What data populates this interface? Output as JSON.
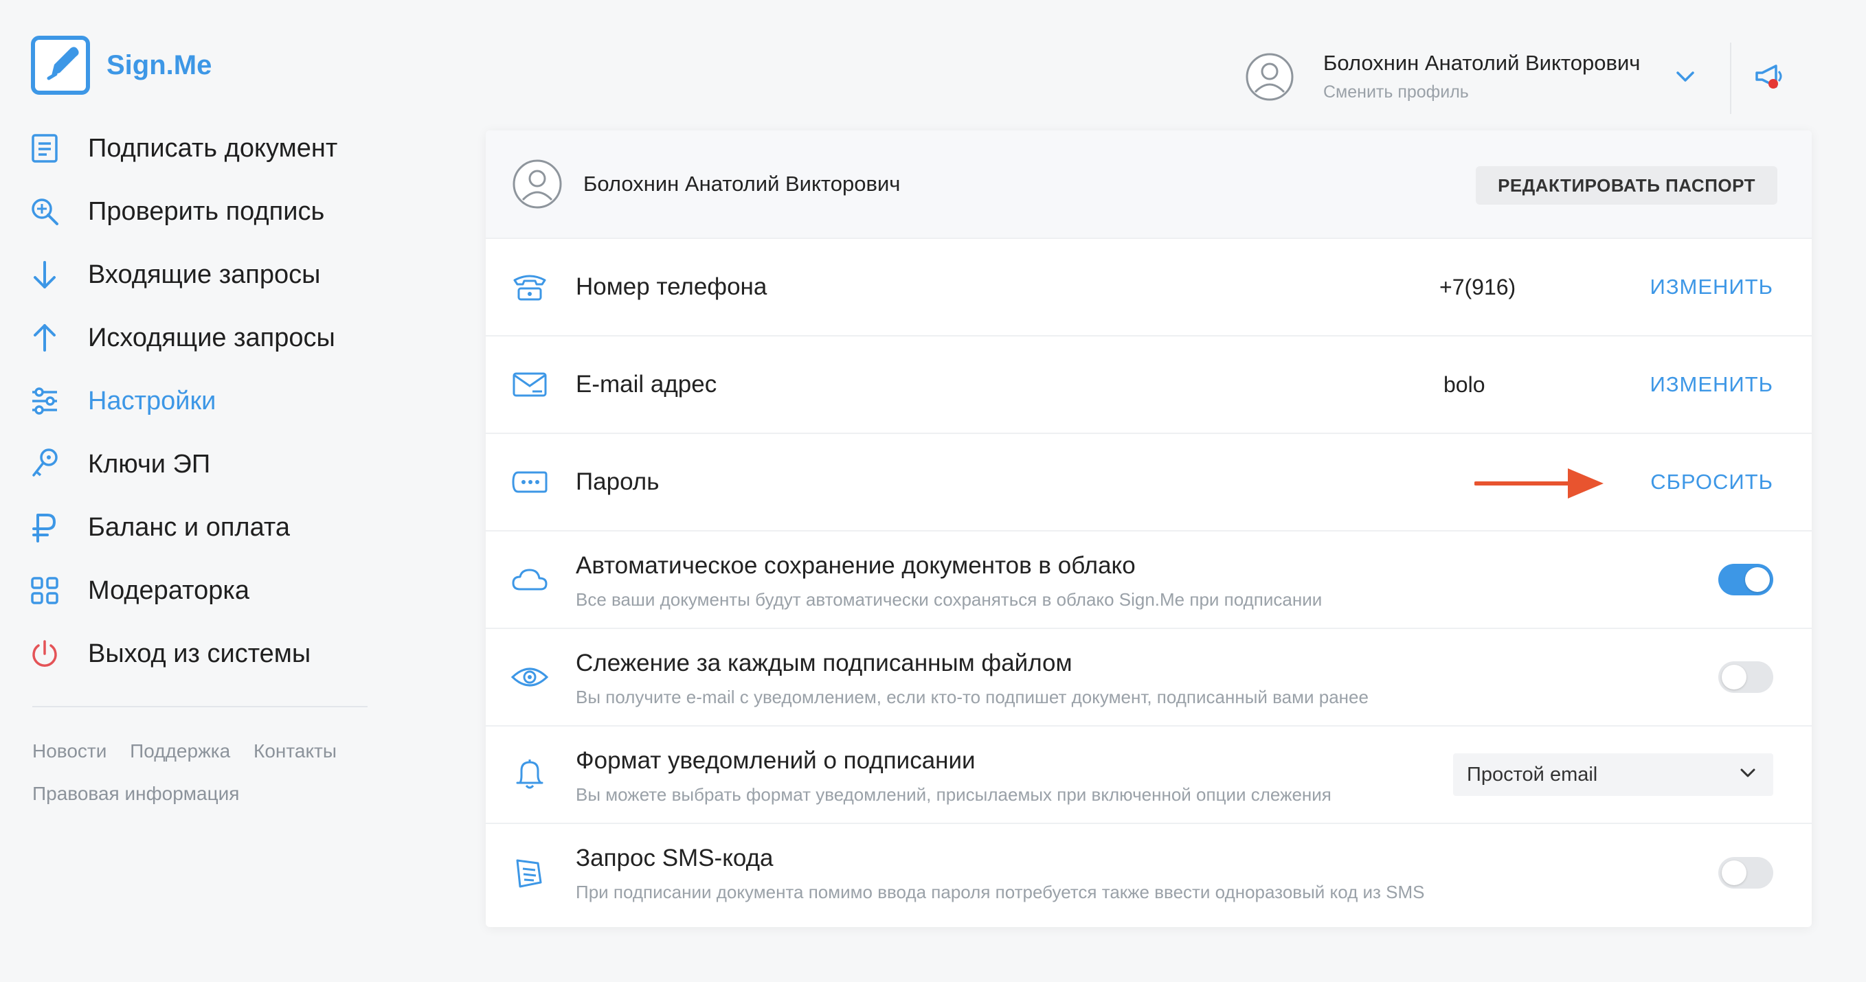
{
  "brand": {
    "name": "Sign.Me",
    "accent": "#3d97e6"
  },
  "sidebar": {
    "items": [
      {
        "label": "Подписать документ",
        "icon": "document-icon",
        "active": false
      },
      {
        "label": "Проверить подпись",
        "icon": "magnifier-plus-icon",
        "active": false
      },
      {
        "label": "Входящие запросы",
        "icon": "arrow-down-icon",
        "active": false
      },
      {
        "label": "Исходящие запросы",
        "icon": "arrow-up-icon",
        "active": false
      },
      {
        "label": "Настройки",
        "icon": "sliders-icon",
        "active": true
      },
      {
        "label": "Ключи ЭП",
        "icon": "key-icon",
        "active": false
      },
      {
        "label": "Баланс и оплата",
        "icon": "ruble-icon",
        "active": false
      },
      {
        "label": "Модераторка",
        "icon": "grid-icon",
        "active": false
      },
      {
        "label": "Выход из системы",
        "icon": "power-icon",
        "active": false
      }
    ],
    "footer_links": [
      "Новости",
      "Поддержка",
      "Контакты"
    ],
    "footer_legal": "Правовая информация"
  },
  "header": {
    "user_name": "Болохнин Анатолий Викторович",
    "switch_profile": "Сменить профиль",
    "notification_color": "#e53935"
  },
  "card": {
    "user_name": "Болохнин Анатолий Викторович",
    "edit_passport": "РЕДАКТИРОВАТЬ ПАСПОРТ",
    "phone": {
      "label": "Номер телефона",
      "value": "+7(916)",
      "action": "ИЗМЕНИТЬ"
    },
    "email": {
      "label": "E-mail адрес",
      "value": "bolo",
      "action": "ИЗМЕНИТЬ"
    },
    "password": {
      "label": "Пароль",
      "action": "СБРОСИТЬ"
    },
    "autosave": {
      "title": "Автоматическое сохранение документов в облако",
      "desc": "Все ваши документы будут автоматически сохраняться в облако Sign.Me при подписании",
      "enabled": true
    },
    "tracking": {
      "title": "Слежение за каждым подписанным файлом",
      "desc": "Вы получите e-mail с уведомлением, если кто-то подпишет документ, подписанный вами ранее",
      "enabled": false
    },
    "notify_format": {
      "title": "Формат уведомлений о подписании",
      "desc": "Вы можете выбрать формат уведомлений, присылаемых при включенной опции слежения",
      "selected": "Простой email"
    },
    "sms": {
      "title": "Запрос SMS-кода",
      "desc": "При подписании документа помимо ввода пароля потребуется также ввести одноразовый код из SMS",
      "enabled": false
    }
  },
  "annotation_color": "#e8542f"
}
